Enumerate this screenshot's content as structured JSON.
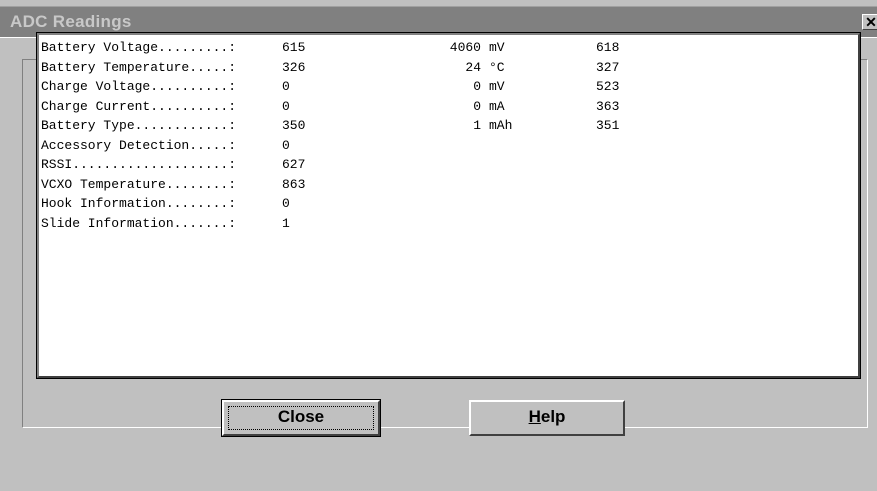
{
  "window": {
    "title": "ADC Readings",
    "close_glyph": "✕"
  },
  "readings": [
    {
      "label": "Battery Voltage.........:",
      "raw": "615",
      "value": "4060",
      "unit": "mV",
      "ref": "618"
    },
    {
      "label": "Battery Temperature.....:",
      "raw": "326",
      "value": "24",
      "unit": "°C",
      "ref": "327"
    },
    {
      "label": "Charge Voltage..........:",
      "raw": "0",
      "value": "0",
      "unit": "mV",
      "ref": "523"
    },
    {
      "label": "Charge Current..........:",
      "raw": "0",
      "value": "0",
      "unit": "mA",
      "ref": "363"
    },
    {
      "label": "Battery Type............:",
      "raw": "350",
      "value": "1",
      "unit": "mAh",
      "ref": "351"
    },
    {
      "label": "Accessory Detection.....:",
      "raw": "0",
      "value": "",
      "unit": "",
      "ref": ""
    },
    {
      "label": "RSSI....................:",
      "raw": "627",
      "value": "",
      "unit": "",
      "ref": ""
    },
    {
      "label": "VCXO Temperature........:",
      "raw": "863",
      "value": "",
      "unit": "",
      "ref": ""
    },
    {
      "label": "Hook Information........:",
      "raw": "0",
      "value": "",
      "unit": "",
      "ref": ""
    },
    {
      "label": "Slide Information.......:",
      "raw": "1",
      "value": "",
      "unit": "",
      "ref": ""
    }
  ],
  "buttons": {
    "close_label": "Close",
    "help_mnemonic": "H",
    "help_rest": "elp"
  }
}
